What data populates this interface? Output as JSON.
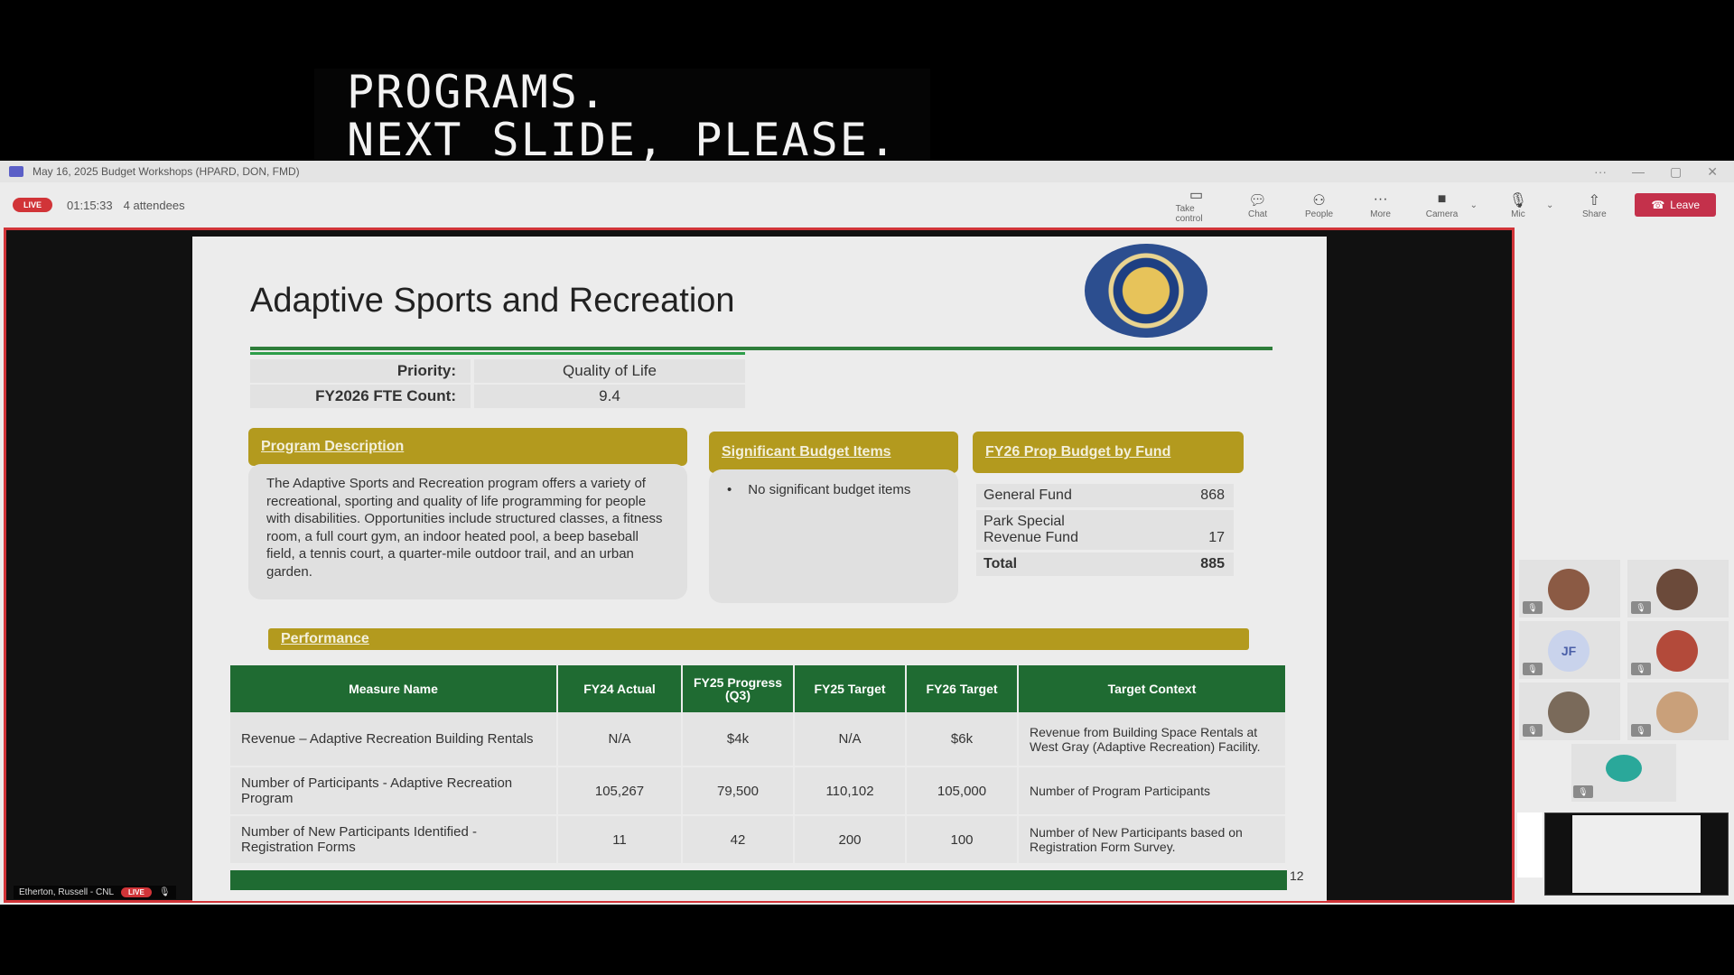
{
  "caption": {
    "line1": "PROGRAMS.",
    "line2": "NEXT SLIDE, PLEASE."
  },
  "window": {
    "title": "May 16, 2025 Budget Workshops (HPARD, DON, FMD)",
    "controls": [
      "···",
      "—",
      "▢",
      "✕"
    ]
  },
  "meeting": {
    "live_label": "LIVE",
    "elapsed": "01:15:33",
    "attendees": "4 attendees",
    "tools": [
      {
        "label": "Take control",
        "icon": "take-control-icon"
      },
      {
        "label": "Chat",
        "icon": "chat-icon"
      },
      {
        "label": "People",
        "icon": "people-icon"
      },
      {
        "label": "More",
        "icon": "more-icon"
      },
      {
        "label": "Camera",
        "icon": "camera-icon"
      },
      {
        "label": "Mic",
        "icon": "mic-icon"
      },
      {
        "label": "Share",
        "icon": "share-icon"
      }
    ],
    "leave_label": "Leave",
    "presenter_name": "Etherton, Russell - CNL",
    "presenter_live": "LIVE"
  },
  "slide": {
    "title": "Adaptive Sports and Recreation",
    "priority_label": "Priority:",
    "priority_value": "Quality of Life",
    "fte_label": "FY2026 FTE Count:",
    "fte_value": "9.4",
    "program_description_header": "Program Description",
    "program_description": "The Adaptive Sports and Recreation program offers a variety of recreational, sporting and quality of life programming for people with disabilities. Opportunities include structured classes, a fitness room, a full court gym, an indoor heated pool, a beep baseball field, a tennis court, a quarter-mile outdoor trail, and an urban garden.",
    "budget_items_header": "Significant Budget Items",
    "budget_items": [
      "No significant budget items"
    ],
    "fund_header": "FY26 Prop Budget by Fund",
    "funds": [
      {
        "name": "General Fund",
        "value": "868"
      },
      {
        "name": "Park  Special Revenue Fund",
        "value": "17"
      }
    ],
    "fund_total_label": "Total",
    "fund_total_value": "885",
    "performance_header": "Performance",
    "perf_columns": [
      "Measure Name",
      "FY24 Actual",
      "FY25 Progress (Q3)",
      "FY25 Target",
      "FY26 Target",
      "Target Context"
    ],
    "perf_rows": [
      {
        "measure": "Revenue – Adaptive Recreation Building Rentals",
        "fy24": "N/A",
        "fy25p": "$4k",
        "fy25t": "N/A",
        "fy26t": "$6k",
        "context": "Revenue from Building Space Rentals at West Gray (Adaptive Recreation) Facility."
      },
      {
        "measure": "Number of Participants - Adaptive Recreation Program",
        "fy24": "105,267",
        "fy25p": "79,500",
        "fy25t": "110,102",
        "fy26t": "105,000",
        "context": "Number of Program Participants"
      },
      {
        "measure": "Number of New Participants Identified - Registration Forms",
        "fy24": "11",
        "fy25p": "42",
        "fy25t": "200",
        "fy26t": "100",
        "context": "Number of New Participants based on Registration Form Survey."
      }
    ],
    "page_number": "12"
  },
  "gallery": {
    "initials_tile": "JF",
    "avatar_colors": [
      "#8b5a44",
      "#6b4a3a",
      "#b34a3a",
      "#7a6a5a",
      "#c9a07a"
    ],
    "accent": "#2aa89a"
  }
}
